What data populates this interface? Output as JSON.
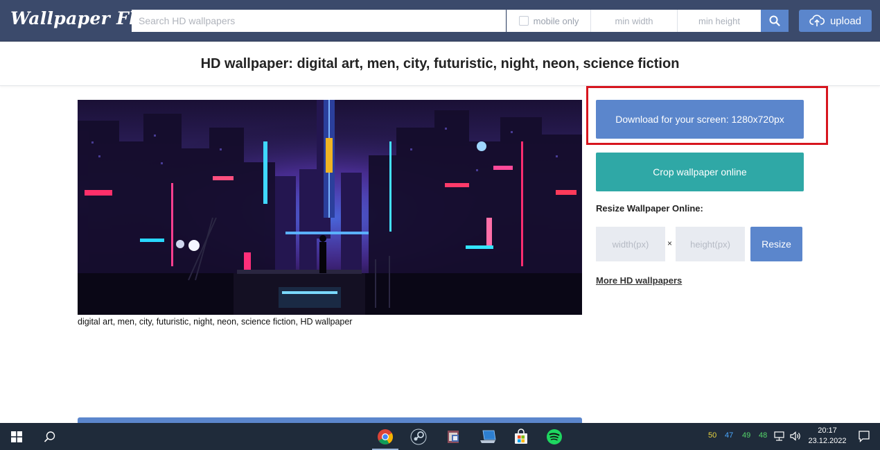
{
  "header": {
    "logo": "Wallpaper Flare",
    "search_placeholder": "Search HD wallpapers",
    "mobile_only": "mobile only",
    "min_width": "min width",
    "min_height": "min height",
    "upload": "upload"
  },
  "page": {
    "title": "HD wallpaper: digital art, men, city, futuristic, night, neon, science fiction",
    "caption": "digital art, men, city, futuristic, night, neon, science fiction, HD wallpaper"
  },
  "sidebar": {
    "download": "Download for your screen: 1280x720px",
    "crop": "Crop wallpaper online",
    "resize_label": "Resize Wallpaper Online:",
    "width_placeholder": "width(px)",
    "height_placeholder": "height(px)",
    "times": "×",
    "resize": "Resize",
    "more": "More HD wallpapers"
  },
  "taskbar": {
    "tray_numbers": [
      {
        "value": "50",
        "color": "#e8d33f"
      },
      {
        "value": "47",
        "color": "#4aa8ff"
      },
      {
        "value": "49",
        "color": "#55d66a"
      },
      {
        "value": "48",
        "color": "#55d66a"
      }
    ],
    "time": "20:17",
    "date": "23.12.2022"
  },
  "colors": {
    "header_bg": "#3b4a6b",
    "accent_blue": "#5b86cc",
    "teal": "#2fa8a6",
    "highlight_red": "#d7151e"
  }
}
